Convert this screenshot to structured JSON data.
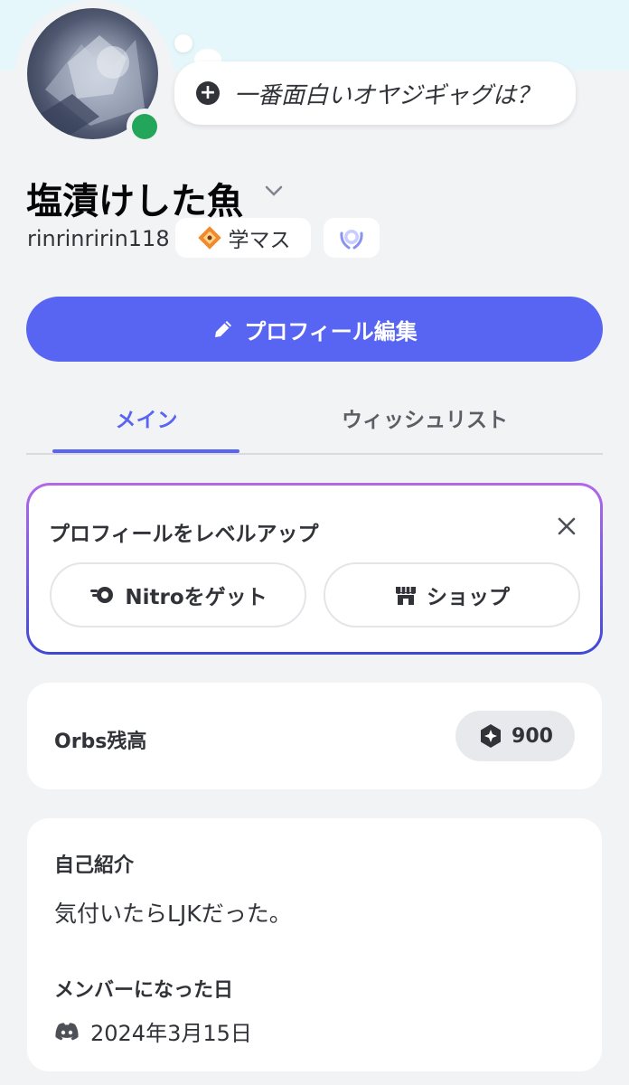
{
  "profile": {
    "status_prompt": "一番面白いオヤジギャグは？",
    "display_name": "塩漬けした魚",
    "username": "rinrinririn118",
    "tag": "学マス",
    "status": "online"
  },
  "actions": {
    "edit_profile": "プロフィール編集"
  },
  "tabs": [
    {
      "label": "メイン",
      "active": true
    },
    {
      "label": "ウィッシュリスト",
      "active": false
    }
  ],
  "level_up": {
    "title": "プロフィールをレベルアップ",
    "nitro_label": "Nitroをゲット",
    "shop_label": "ショップ"
  },
  "orbs": {
    "label": "Orbs残高",
    "value": "900"
  },
  "about": {
    "bio_heading": "自己紹介",
    "bio": "気付いたらLJKだった。",
    "member_since_heading": "メンバーになった日",
    "member_since": "2024年3月15日"
  },
  "colors": {
    "accent": "#5865f2",
    "online": "#23a55a",
    "background": "#f2f3f5"
  },
  "icons": [
    "plus-icon",
    "chevron-down-icon",
    "tag-icon",
    "laurel-badge-icon",
    "pencil-icon",
    "close-icon",
    "nitro-icon",
    "shop-icon",
    "orb-icon",
    "discord-icon"
  ]
}
